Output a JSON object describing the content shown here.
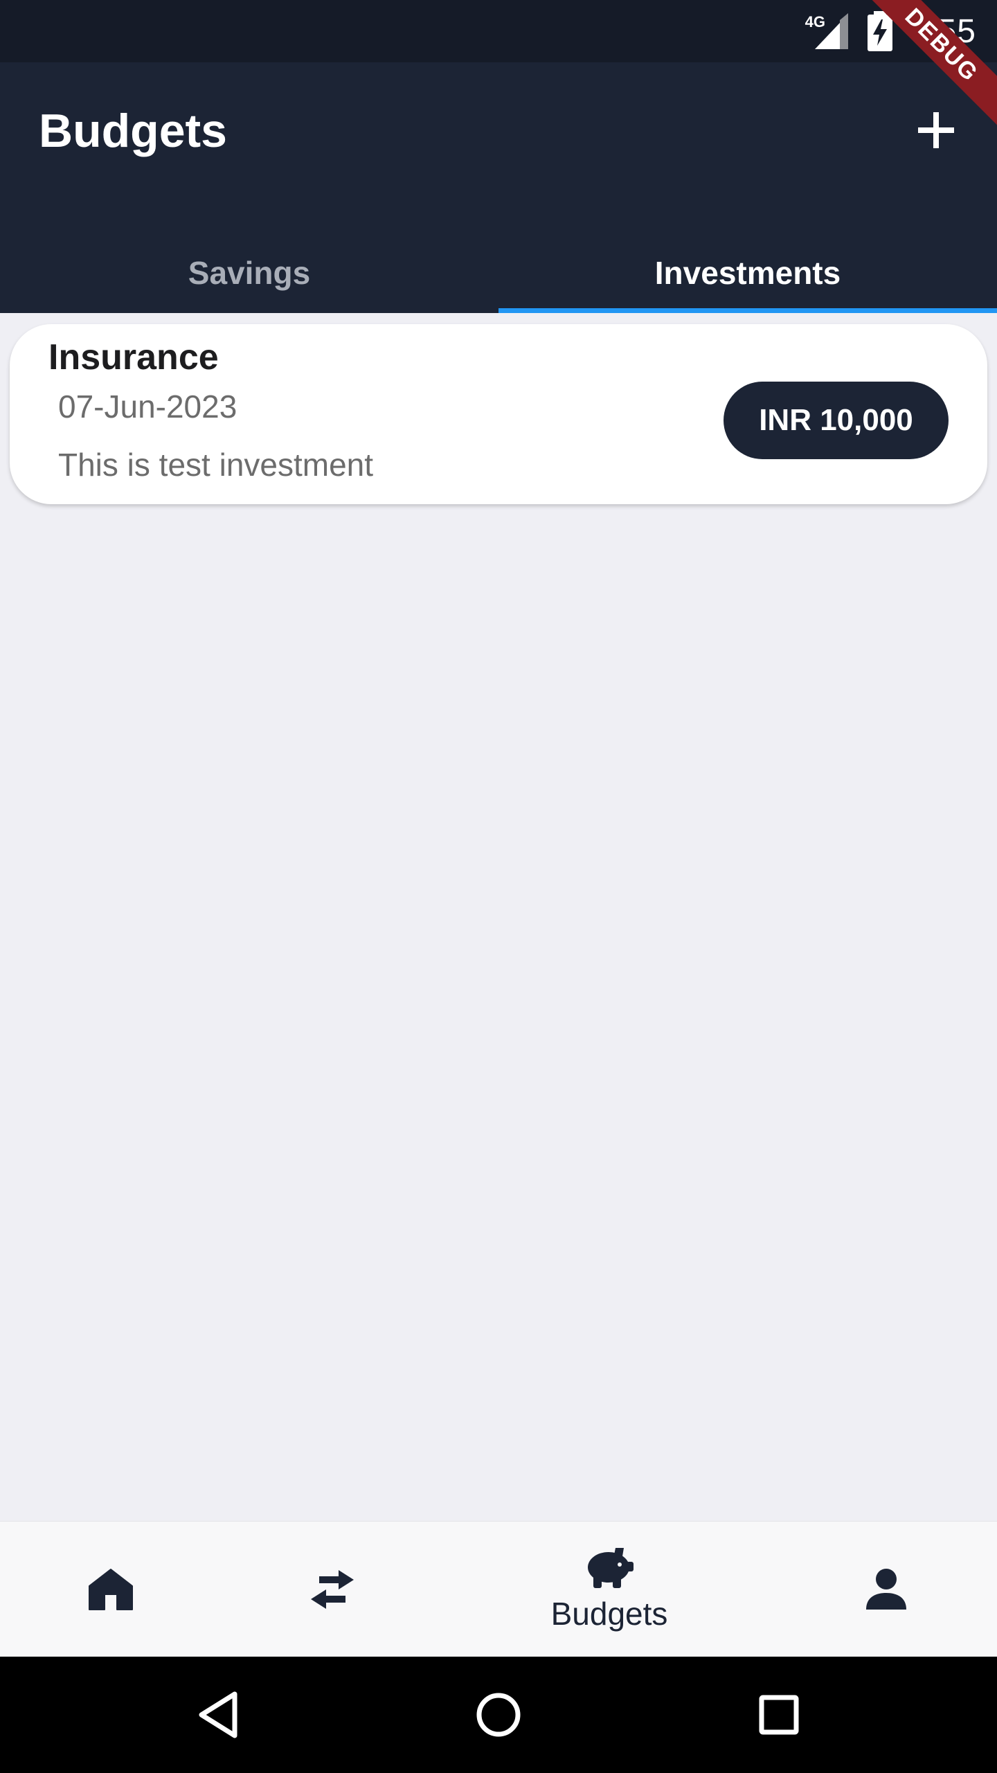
{
  "status_bar": {
    "network": "4G",
    "time": "6:55",
    "debug_label": "DEBUG"
  },
  "app_bar": {
    "title": "Budgets",
    "add_icon": "plus-icon"
  },
  "tabs": [
    {
      "label": "Savings",
      "active": false
    },
    {
      "label": "Investments",
      "active": true
    }
  ],
  "investments": [
    {
      "title": "Insurance",
      "date": "07-Jun-2023",
      "description": "This is test investment",
      "amount": "INR 10,000"
    }
  ],
  "bottom_nav": {
    "items": [
      {
        "icon": "home-icon",
        "label": ""
      },
      {
        "icon": "swap-arrows-icon",
        "label": ""
      },
      {
        "icon": "piggy-bank-icon",
        "label": "Budgets",
        "active": true
      },
      {
        "icon": "person-icon",
        "label": ""
      }
    ]
  },
  "colors": {
    "app_bar": "#1c2435",
    "status_bar": "#151b28",
    "tab_indicator": "#2196f3",
    "background": "#efeff4",
    "debug_ribbon": "#8b1d22"
  }
}
